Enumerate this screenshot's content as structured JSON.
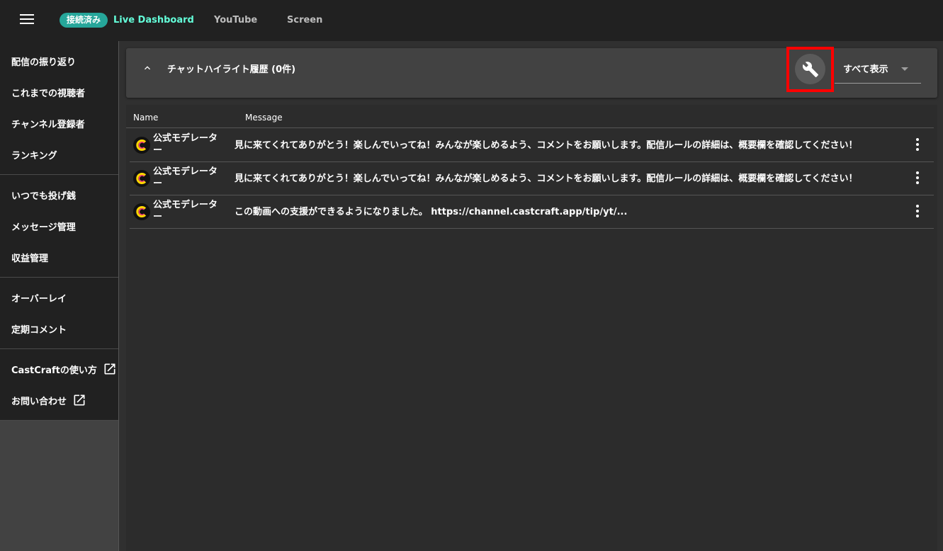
{
  "header": {
    "menu_icon": "hamburger-menu-icon",
    "status_badge": "接続済み",
    "tabs": [
      "Live Dashboard",
      "YouTube",
      "Screen"
    ],
    "accent_color": "#64ffda",
    "badge_color": "#26a69a"
  },
  "sidebar": {
    "groups": [
      [
        "配信の振り返り",
        "これまでの視聴者",
        "チャンネル登録者",
        "ランキング"
      ],
      [
        "いつでも投げ銭",
        "メッセージ管理",
        "収益管理"
      ],
      [
        "オーバーレイ",
        "定期コメント"
      ],
      [
        "CastCraftの使い方",
        "お問い合わせ"
      ]
    ],
    "external_icon": "open-in-new-icon"
  },
  "panel": {
    "title": "チャットハイライト履歴 (0件)",
    "collapse_icon": "chevron-up-icon",
    "settings_icon": "wrench-icon",
    "filter_value": "すべて表示",
    "highlight_color": "#ff0000"
  },
  "table": {
    "headers": [
      "Name",
      "Message"
    ],
    "rows": [
      {
        "author": "公式モデレーター",
        "message": "見に来てくれてありがとう！楽しんでいってね！みんなが楽しめるよう、コメントをお願いします。配信ルールの詳細は、概要欄を確認してください！"
      },
      {
        "author": "公式モデレーター",
        "message": "見に来てくれてありがとう！楽しんでいってね！みんなが楽しめるよう、コメントをお願いします。配信ルールの詳細は、概要欄を確認してください！"
      },
      {
        "author": "公式モデレーター",
        "message": "この動画への支援ができるようになりました。 https://channel.castcraft.app/tip/yt/..."
      }
    ],
    "row_menu_icon": "more-vert-icon",
    "avatar_icon": "castcraft-logo-icon"
  }
}
